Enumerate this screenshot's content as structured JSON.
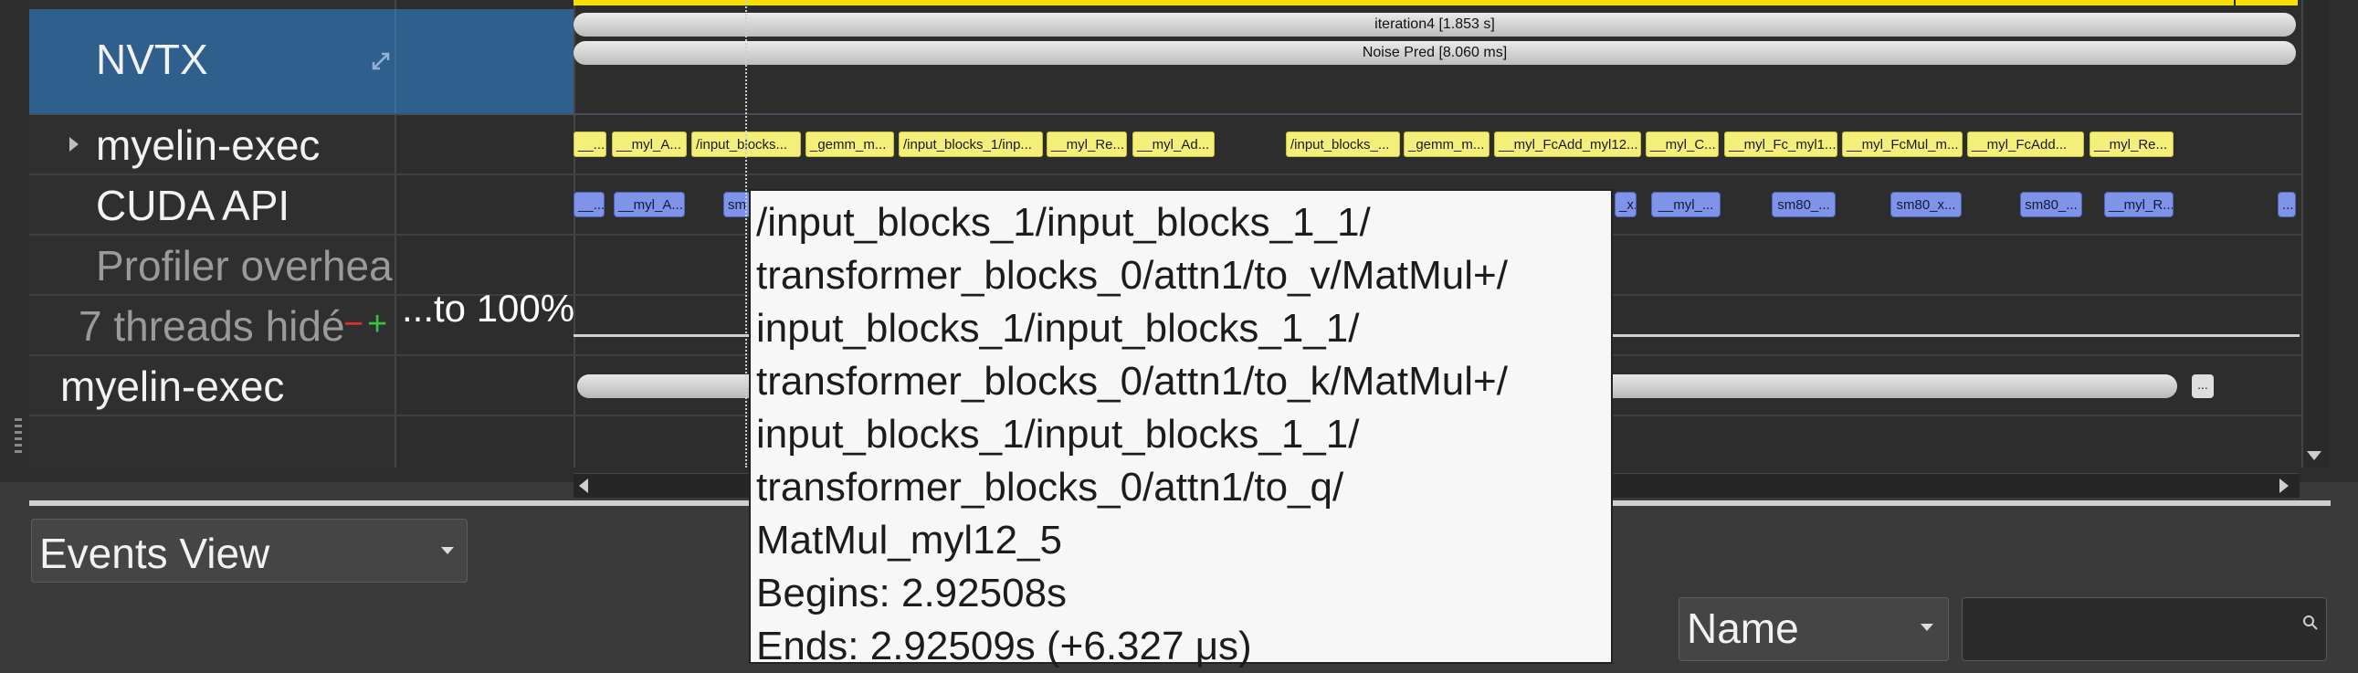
{
  "rows": {
    "nvtx": "NVTX",
    "myelin_exec_child": "myelin-exec",
    "cuda_api": "CUDA API",
    "profiler_overhead": "Profiler overhea",
    "threads_hidden": "7 threads hidé",
    "threads_minus": "−",
    "threads_plus": "+",
    "to_100": "...to 100%",
    "myelin_exec": "myelin-exec"
  },
  "nvtx_bars": {
    "iteration": "iteration4 [1.853 s]",
    "noise_pred": "Noise Pred [8.060 ms]"
  },
  "myelin_chips": [
    "__...",
    "__myl_A...",
    "/input_blocks...",
    "_gemm_m...",
    "/input_blocks_1/inp...",
    "__myl_Re...",
    "__myl_Ad...",
    "/input_blocks_...",
    "_gemm_m...",
    "__myl_FcAdd_myl12...",
    "__myl_C...",
    "__myl_Fc_myl1...",
    "__myl_FcMul_m...",
    "__myl_FcAdd...",
    "__myl_Re..."
  ],
  "cuda_chips": [
    "__...",
    "__myl_A...",
    "sm",
    "_x...",
    "__myl_...",
    "sm80_...",
    "sm80_x...",
    "sm80_...",
    "__myl_R...",
    "..."
  ],
  "more_button": "...",
  "tooltip": {
    "lines": [
      "/input_blocks_1/input_blocks_1_1/",
      "transformer_blocks_0/attn1/to_v/MatMul+/",
      "input_blocks_1/input_blocks_1_1/",
      "transformer_blocks_0/attn1/to_k/MatMul+/",
      "input_blocks_1/input_blocks_1_1/",
      "transformer_blocks_0/attn1/to_q/",
      "MatMul_myl12_5"
    ],
    "begins": "Begins: 2.92508s",
    "ends": "Ends: 2.92509s (+6.327 μs)"
  },
  "bottom": {
    "events_view": "Events View",
    "name_filter": "Name",
    "search_value": ""
  },
  "colors": {
    "nvtx_row": "#2f5f8c",
    "chip_yellow": "#f4ef7a",
    "chip_blue": "#7f94e8",
    "nvtx_top_bar": "#f4e100"
  },
  "icons": [
    "expand-icon",
    "triangle-right-icon",
    "scroll-up-icon",
    "scroll-down-icon",
    "scroll-left-icon",
    "scroll-right-icon",
    "dropdown-caret-icon",
    "search-icon",
    "drag-handle-icon"
  ]
}
